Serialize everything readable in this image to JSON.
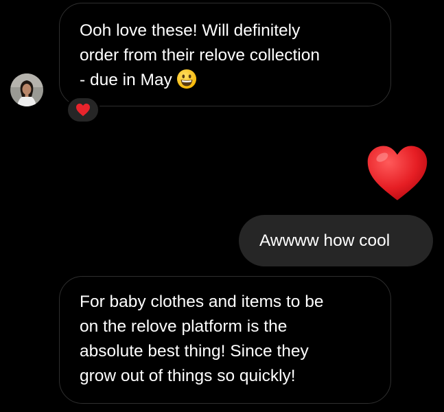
{
  "thread": {
    "incoming_message_1": {
      "lines": [
        "Ooh love these! Will definitely",
        "order from their relove collection",
        "- due in May"
      ],
      "trailing_emoji": "grinning-face-icon"
    },
    "reaction": {
      "emoji": "red-heart-icon"
    },
    "sticker": {
      "emoji": "red-heart-icon"
    },
    "outgoing_message": {
      "text": "Awwww how cool"
    },
    "incoming_message_2": {
      "lines": [
        "For baby clothes and items to be",
        "on the relove platform is the",
        "absolute best thing! Since they",
        "grow out of things so quickly!"
      ]
    }
  },
  "colors": {
    "background": "#000000",
    "incoming_border": "#2f2f2f",
    "outgoing_bubble": "#262626",
    "reaction_pill": "#262626",
    "heart_red": "#e8242c",
    "text": "#ffffff"
  }
}
